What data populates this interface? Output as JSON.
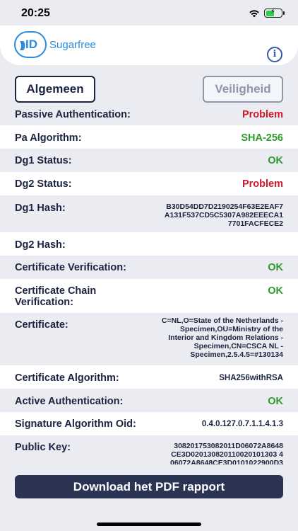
{
  "status_bar": {
    "time": "20:25"
  },
  "header": {
    "logo_id": "ID",
    "logo_name": "Sugarfree",
    "info_icon": "i"
  },
  "tabs": {
    "general": "Algemeen",
    "security": "Veiligheid"
  },
  "rows": [
    {
      "label": "Passive Authentication:",
      "value": "Problem",
      "status": "red"
    },
    {
      "label": "Pa Algorithm:",
      "value": "SHA-256",
      "status": "green"
    },
    {
      "label": "Dg1 Status:",
      "value": "OK",
      "status": "green"
    },
    {
      "label": "Dg2 Status:",
      "value": "Problem",
      "status": "red"
    },
    {
      "label": "Dg1 Hash:",
      "value_lines": [
        "B30D54DD7D2190254F63E2EAF7",
        "A131F537CD5C5307A982EEECA1",
        "7701FACFECE2"
      ]
    },
    {
      "label": "Dg2 Hash:",
      "value": ""
    },
    {
      "label": "Certificate Verification:",
      "value": "OK",
      "status": "green"
    },
    {
      "label_lines": [
        "Certificate Chain",
        "Verification:"
      ],
      "value": "OK",
      "status": "green"
    },
    {
      "label": "Certificate:",
      "value_lines": [
        "C=NL,O=State of the Netherlands -",
        "Specimen,OU=Ministry of the",
        "Interior and Kingdom Relations -",
        "Specimen,CN=CSCA NL -",
        "Specimen,2.5.4.5=#130134"
      ]
    },
    {
      "label": "Certificate Algorithm:",
      "value": "SHA256withRSA"
    },
    {
      "label": "Active Authentication:",
      "value": "OK",
      "status": "green"
    },
    {
      "label": "Signature Algorithm Oid:",
      "value": "0.4.0.127.0.7.1.1.4.1.3"
    },
    {
      "label": "Public Key:",
      "value_lines": [
        "308201753082011D06072A8648",
        "CE3D020130820110020101303 4",
        "06072A8648CE3D0101022900D3"
      ]
    }
  ],
  "footer": {
    "download_button": "Download het PDF rapport"
  },
  "colors": {
    "problem": "#d0182a",
    "ok": "#2e9a2e",
    "primary": "#1c2340",
    "button": "#2c3454"
  }
}
